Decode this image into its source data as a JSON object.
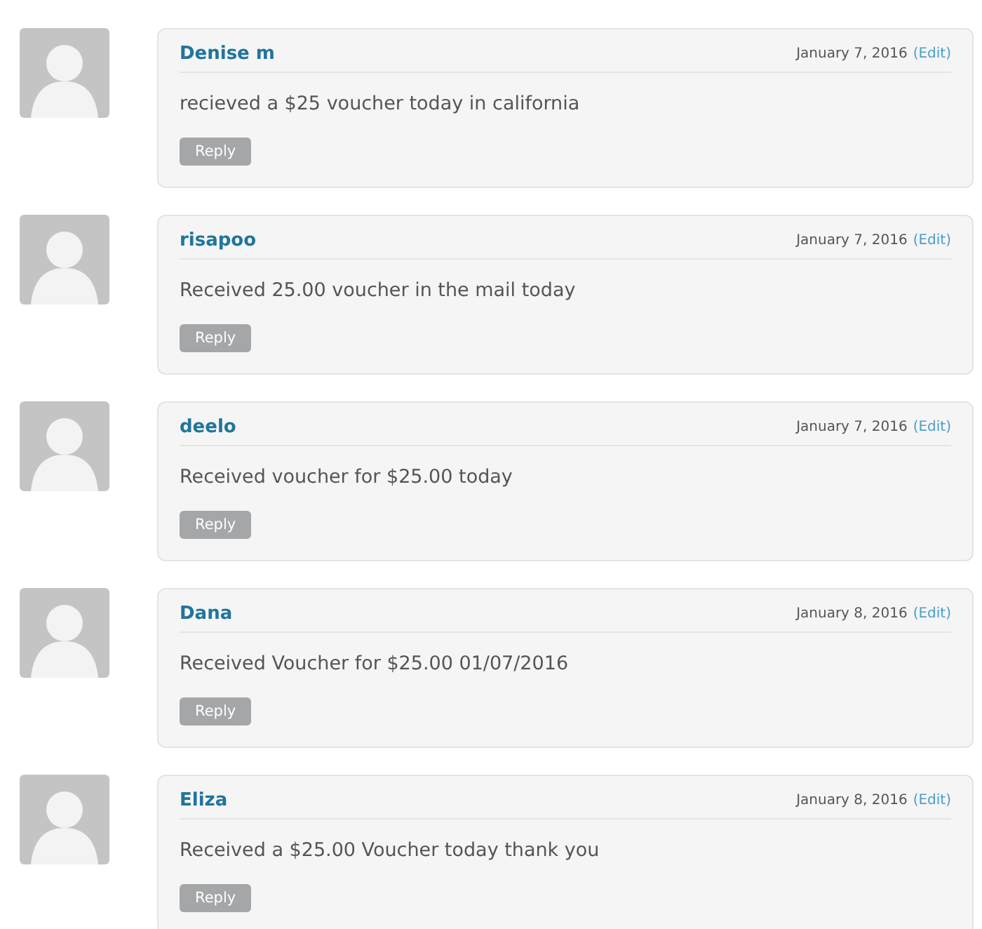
{
  "comments": [
    {
      "author": "Denise m",
      "date": "January 7, 2016",
      "edit": "(Edit)",
      "text": "recieved a $25 voucher today in california",
      "reply": "Reply"
    },
    {
      "author": "risapoo",
      "date": "January 7, 2016",
      "edit": "(Edit)",
      "text": "Received 25.00 voucher in the mail today",
      "reply": "Reply"
    },
    {
      "author": "deelo",
      "date": "January 7, 2016",
      "edit": "(Edit)",
      "text": "Received voucher for $25.00 today",
      "reply": "Reply"
    },
    {
      "author": "Dana",
      "date": "January 8, 2016",
      "edit": "(Edit)",
      "text": "Received Voucher for $25.00 01/07/2016",
      "reply": "Reply"
    },
    {
      "author": "Eliza",
      "date": "January 8, 2016",
      "edit": "(Edit)",
      "text": "Received a $25.00 Voucher today thank you",
      "reply": "Reply"
    }
  ]
}
